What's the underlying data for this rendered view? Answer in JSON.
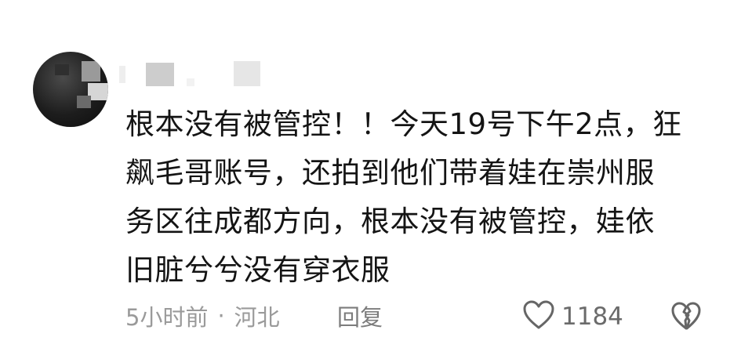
{
  "comment": {
    "lines": [
      "根本没有被管控！！今天19号下午2点，狂",
      "飙毛哥账号，还拍到他们带着娃在崇州服",
      "务区往成都方向，根本没有被管控，娃依",
      "旧脏兮兮没有穿衣服"
    ]
  },
  "meta": {
    "time": "5小时前",
    "separator": "·",
    "location": "河北",
    "reply_label": "回复"
  },
  "likes": {
    "count": "1184"
  },
  "icons": {
    "like": "heart-outline-icon",
    "dislike": "broken-heart-icon"
  },
  "colors": {
    "text": "#141414",
    "meta": "#9a9a9a",
    "icon": "#666666"
  }
}
